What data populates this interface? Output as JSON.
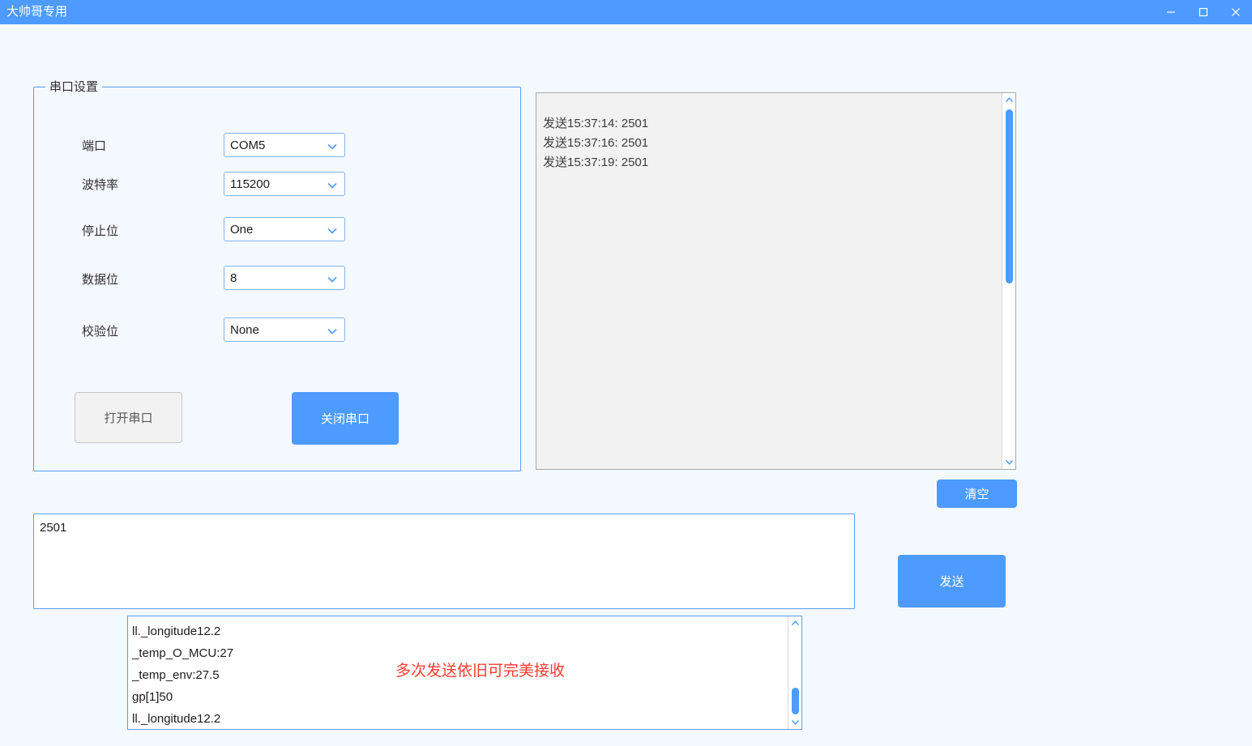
{
  "window": {
    "title": "大帅哥专用",
    "controls": [
      {
        "name": "minimize",
        "glyph": "minimize-icon"
      },
      {
        "name": "maximize",
        "glyph": "maximize-icon"
      },
      {
        "name": "close",
        "glyph": "close-icon"
      }
    ]
  },
  "serial_settings": {
    "legend": "串口设置",
    "fields": [
      {
        "label": "端口",
        "value": "COM5"
      },
      {
        "label": "波特率",
        "value": "115200"
      },
      {
        "label": "停止位",
        "value": "One"
      },
      {
        "label": "数据位",
        "value": "8"
      },
      {
        "label": "校验位",
        "value": "None"
      }
    ],
    "open_button": "打开串口",
    "close_button": "关闭串口"
  },
  "receive_log": {
    "lines": [
      "发送15:37:14: 2501",
      "发送15:37:16: 2501",
      "发送15:37:19: 2501"
    ],
    "clear_button": "清空"
  },
  "send_area": {
    "value": "2501",
    "placeholder": "",
    "send_button": "发送"
  },
  "received_list": {
    "lines": [
      "ll._longitude12.2",
      "_temp_O_MCU:27",
      "_temp_env:27.5",
      "gp[1]50",
      "ll._longitude12.2"
    ]
  },
  "annotation": {
    "text": "多次发送依旧可完美接收"
  },
  "colors": {
    "accent": "#4d9bff",
    "page_bg": "#f4f8ff",
    "log_bg": "#f2f2f2",
    "annotation": "#ff3b30"
  }
}
